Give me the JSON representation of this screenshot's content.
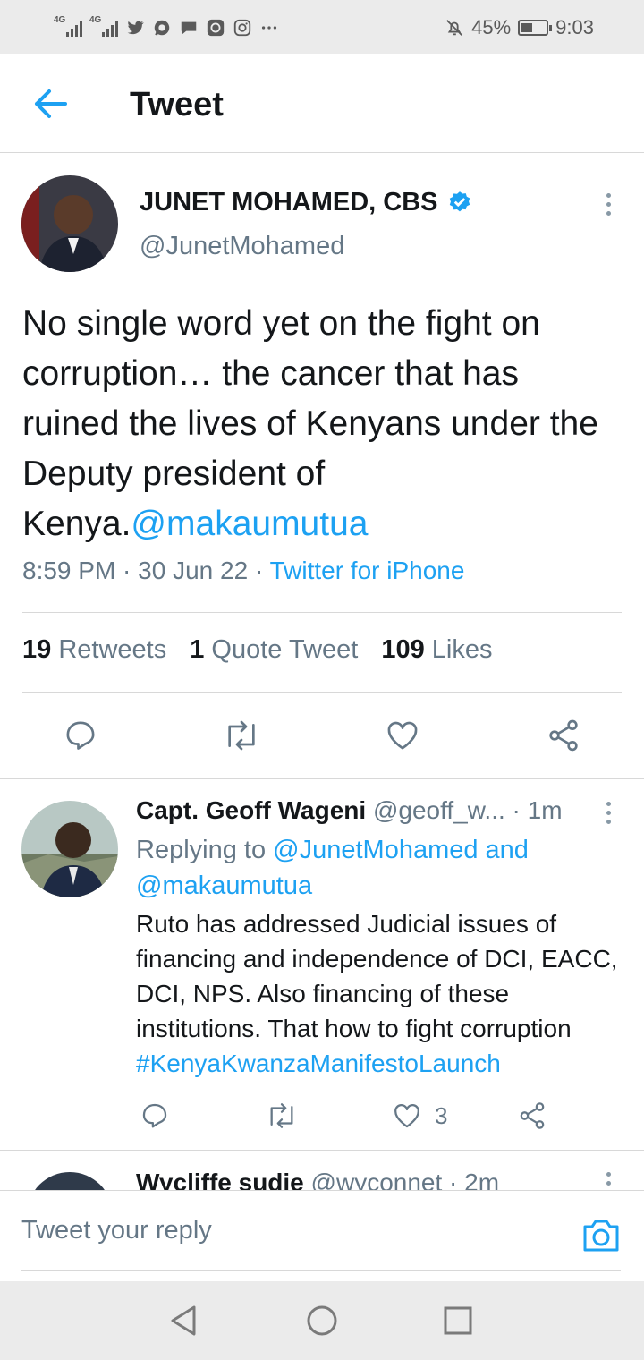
{
  "status_bar": {
    "signal_1": "4G",
    "signal_2": "4G",
    "battery": "45%",
    "time": "9:03",
    "battery_level": 0.45,
    "notification_icons": [
      "twitter-icon",
      "whatsapp-icon",
      "message-icon",
      "app-icon",
      "instagram-icon",
      "more-dots-icon"
    ]
  },
  "header": {
    "title": "Tweet"
  },
  "main_tweet": {
    "author_name": "JUNET MOHAMED, CBS",
    "verified": true,
    "handle": "@JunetMohamed",
    "text": "No single word yet on the fight on corruption… the cancer that has ruined the lives of Kenyans under the Deputy president of Kenya.",
    "mention": "@makaumutua",
    "time": "8:59 PM",
    "date": "30 Jun 22",
    "source": "Twitter for iPhone",
    "retweets_count": "19",
    "retweets_label": "Retweets",
    "quotes_count": "1",
    "quotes_label": "Quote Tweet",
    "likes_count": "109",
    "likes_label": "Likes"
  },
  "reply": {
    "author_name": "Capt. Geoff Wageni",
    "handle": "@geoff_w...",
    "time_ago": "1m",
    "replying_prefix": "Replying to",
    "replying_to_1": "@JunetMohamed and",
    "replying_to_2": "@makaumutua",
    "text": "Ruto has addressed Judicial issues of financing and independence of DCI, EACC, DCI, NPS. Also financing of these institutions. That how to fight corruption",
    "hashtag": "#KenyaKwanzaManifestoLaunch",
    "likes": "3"
  },
  "next_reply": {
    "author_name": "Wycliffe sudie",
    "handle": "@wyconnet",
    "time_ago": "2m"
  },
  "reply_bar": {
    "placeholder": "Tweet your reply"
  },
  "colors": {
    "accent": "#1da1f2",
    "text": "#14171a",
    "secondary": "#657786",
    "divider": "#d8d8d8"
  }
}
